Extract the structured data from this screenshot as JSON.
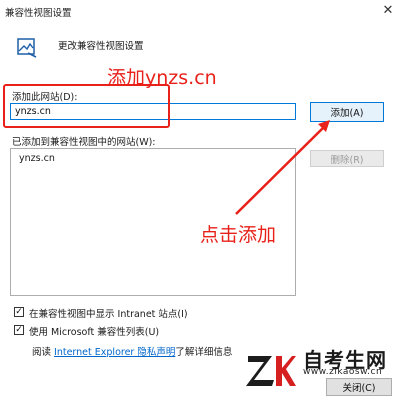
{
  "window": {
    "title": "兼容性视图设置",
    "close_glyph": "✕"
  },
  "header": {
    "icon": "compat-view-icon",
    "text": "更改兼容性视图设置"
  },
  "add_site": {
    "label": "添加此网站(D):",
    "value": "ynzs.cn",
    "add_button": "添加(A)"
  },
  "site_list": {
    "label": "已添加到兼容性视图中的网站(W):",
    "items": [
      "ynzs.cn"
    ],
    "remove_button": "删除(R)"
  },
  "options": {
    "intranet_label": "在兼容性视图中显示 Intranet 站点(I)",
    "intranet_checked": true,
    "mslist_label": "使用 Microsoft 兼容性列表(U)",
    "mslist_checked": true,
    "check_glyph": "✓"
  },
  "privacy": {
    "prefix": "阅读 ",
    "link": "Internet Explorer 隐私声明",
    "suffix": "了解详细信息"
  },
  "footer": {
    "close_button": "关闭(C)"
  },
  "annotations": {
    "top_note": "添加ynzs.cn",
    "click_note": "点击添加",
    "color": "#e8211a"
  },
  "watermark": {
    "logo_text": "ZK",
    "brand": "自考生网",
    "url": "www.zikaosw.cn"
  }
}
